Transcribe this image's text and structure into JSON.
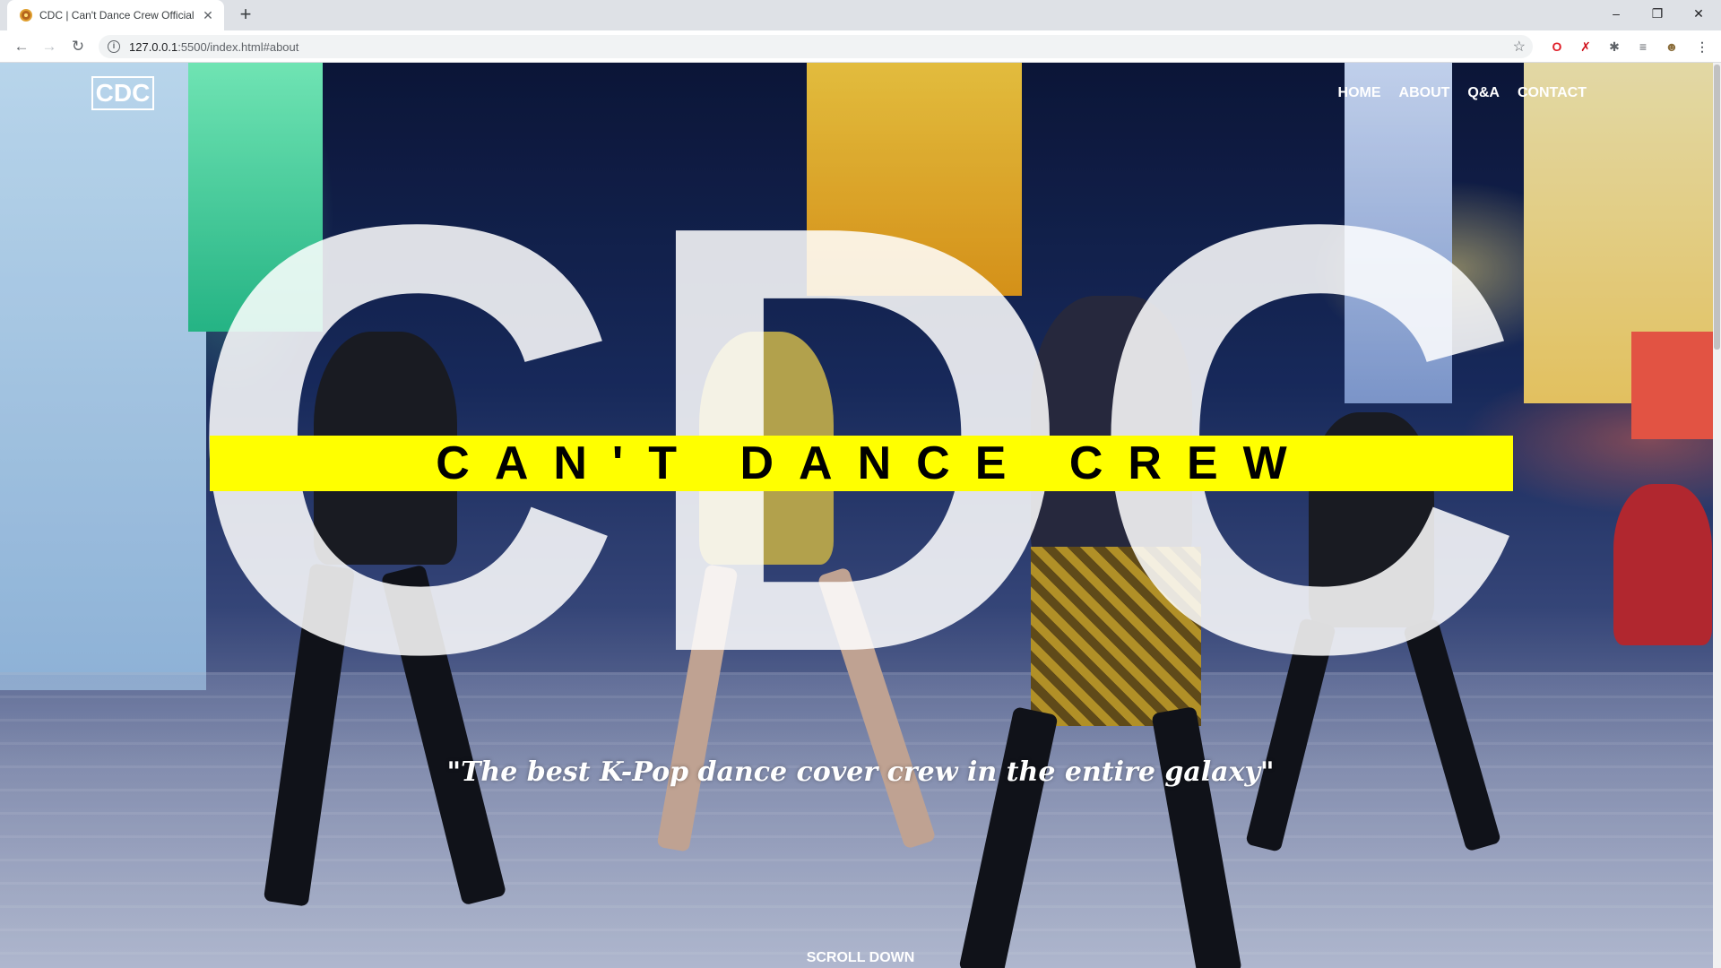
{
  "browser": {
    "tab_title": "CDC | Can't Dance Crew Official W",
    "tab_close": "✕",
    "new_tab": "+",
    "url_host": "127.0.0.1",
    "url_rest": ":5500/index.html#about",
    "nav_back": "←",
    "nav_forward": "→",
    "nav_reload": "↻",
    "bookmark_icon": "☆",
    "window_minimize": "–",
    "window_restore": "❐",
    "window_close": "✕",
    "menu_icon": "⋮"
  },
  "site": {
    "logo": "CDC",
    "nav": [
      {
        "label": "HOME"
      },
      {
        "label": "ABOUT"
      },
      {
        "label": "Q&A"
      },
      {
        "label": "CONTACT"
      }
    ],
    "hero": {
      "big_text": "CDC",
      "band_text": "CAN'T DANCE CREW",
      "tagline": "\"The best K-Pop dance cover crew in the entire galaxy\"",
      "scroll_label": "SCROLL DOWN",
      "band_color": "#ffff00"
    }
  }
}
